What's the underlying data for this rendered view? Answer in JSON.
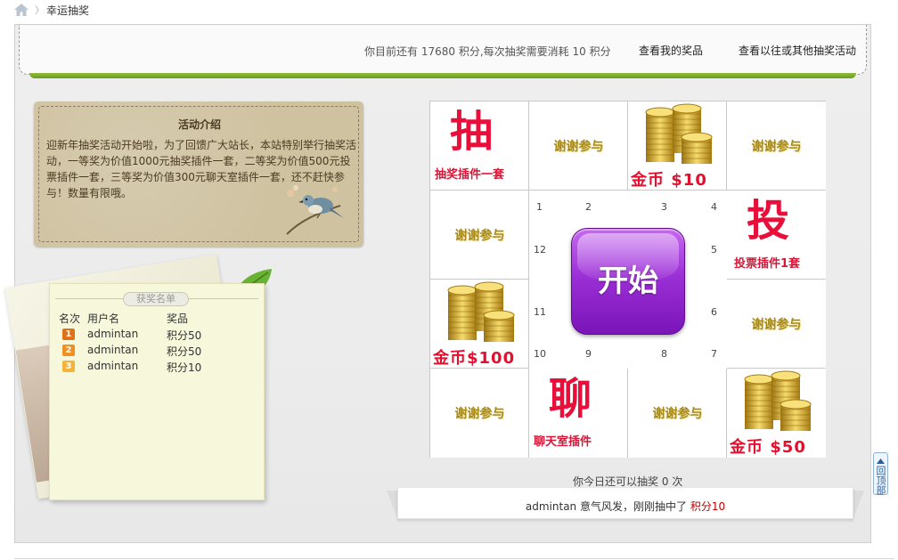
{
  "breadcrumb": {
    "home_icon": "home-icon",
    "separator": "〉",
    "current": "幸运抽奖"
  },
  "topbar": {
    "points_prefix": "你目前还有",
    "points": "17680",
    "points_mid": "积分,每次抽奖需要消耗",
    "cost": "10",
    "points_suffix": "积分",
    "my_prizes_link": "查看我的奖品",
    "other_activities_link": "查看以往或其他抽奖活动"
  },
  "intro": {
    "title": "活动介绍",
    "text": "迎新年抽奖活动开始啦，为了回馈广大站长，本站特别举行抽奖活动，一等奖为价值1000元抽奖插件一套，二等奖为价值500元投票插件一套，三等奖为价值300元聊天室插件一套，还不赶快参与！数量有限哦。"
  },
  "winners": {
    "tab_label": "获奖名单",
    "headers": {
      "rank": "名次",
      "user": "用户名",
      "prize": "奖品"
    },
    "rows": [
      {
        "rank": "1",
        "user": "admintan",
        "prize": "积分50",
        "color": "#e0711c"
      },
      {
        "rank": "2",
        "user": "admintan",
        "prize": "积分50",
        "color": "#f08f22"
      },
      {
        "rank": "3",
        "user": "admintan",
        "prize": "积分10",
        "color": "#f4b43c"
      }
    ]
  },
  "grid": {
    "thanks_label": "谢谢参与",
    "cells": {
      "c1": {
        "char": "抽",
        "label": "抽奖插件一套"
      },
      "c3": {
        "label": "金币 $10"
      },
      "c5": {
        "char": "投",
        "label": "投票插件1套"
      },
      "c11": {
        "label": "金币 $50"
      },
      "c13": {
        "char": "聊",
        "label": "聊天室插件"
      },
      "c16": {
        "label": "金币$100"
      }
    },
    "numbers": [
      "1",
      "2",
      "3",
      "4",
      "5",
      "6",
      "7",
      "8",
      "9",
      "10",
      "11",
      "12"
    ],
    "start_label": "开始",
    "coin_icon": "gold-coins-icon"
  },
  "status": {
    "remaining_prefix": "你今日还可以抽奖",
    "remaining": "0",
    "remaining_suffix": "次"
  },
  "ticker": {
    "user": "admintan",
    "message": "意气风发，刚刚抽中了",
    "prize": "积分10"
  },
  "back_to_top": "回顶部",
  "colors": {
    "accent_green": "#7aab2a",
    "prize_red": "#e2102e",
    "start_purple": "#9b2fd6",
    "thanks_gold": "#a88a1a"
  }
}
